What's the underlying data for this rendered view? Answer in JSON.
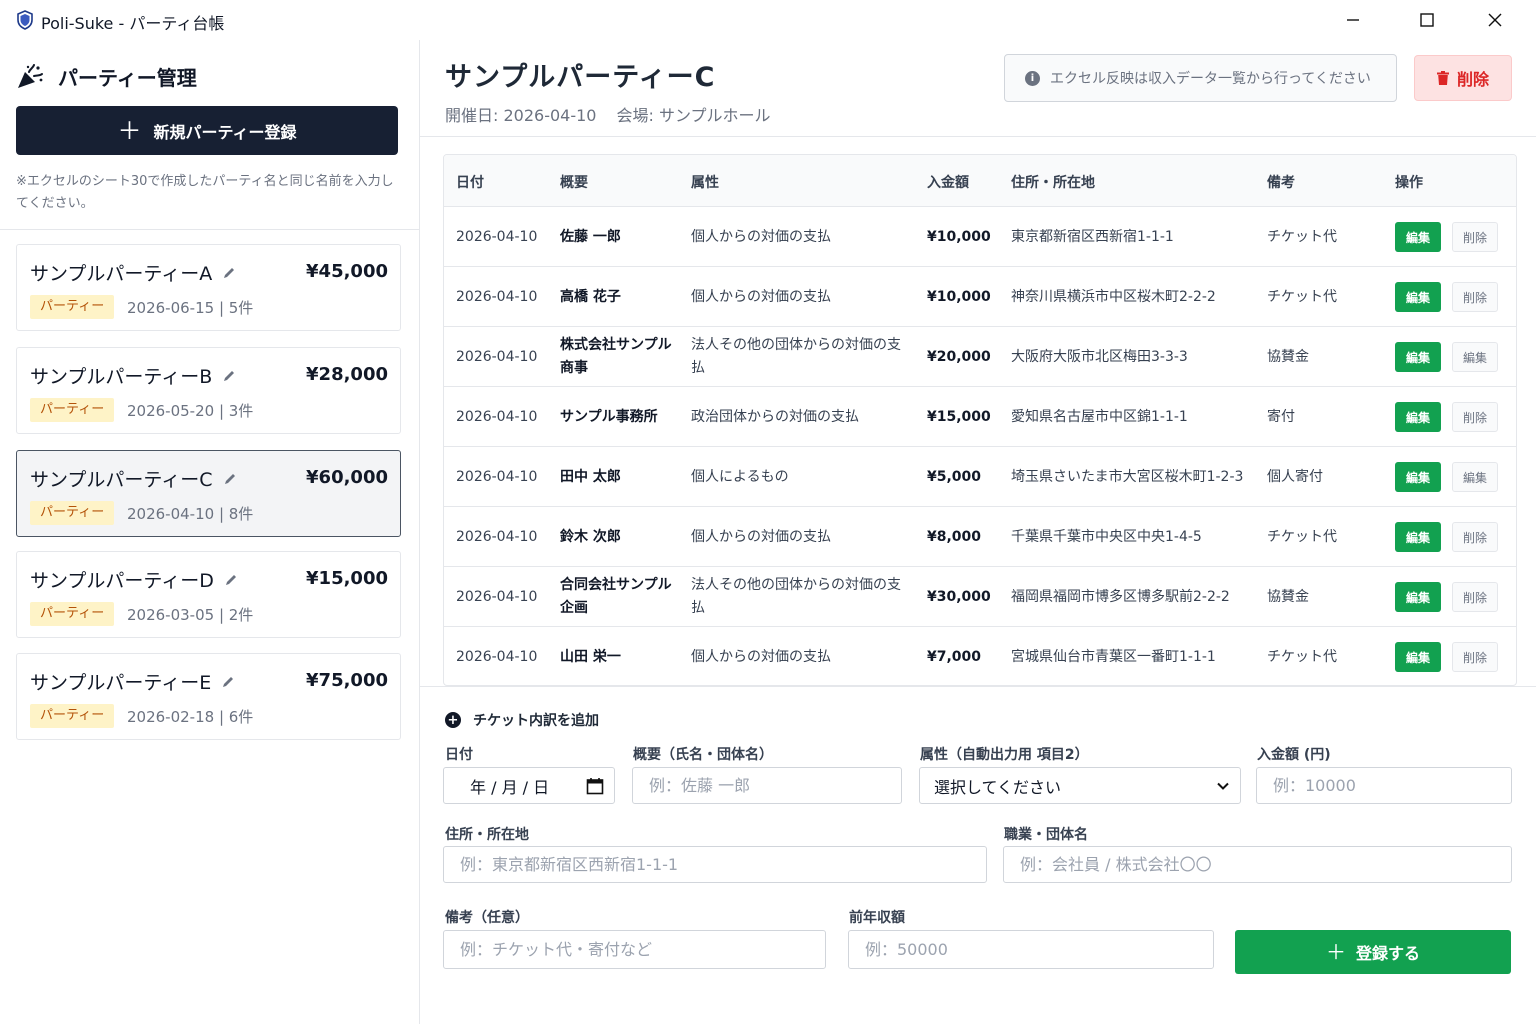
{
  "window": {
    "title": "Poli-Suke - パーティ台帳"
  },
  "sidebar": {
    "title": "パーティー管理",
    "new_button_label": "新規パーティー登録",
    "note": "※エクセルのシート30で作成したパーティ名と同じ名前を入力してください。",
    "parties": [
      {
        "name": "サンプルパーティーA",
        "amount": "¥45,000",
        "badge": "パーティー",
        "meta": "2026-06-15 | 5件",
        "selected": false
      },
      {
        "name": "サンプルパーティーB",
        "amount": "¥28,000",
        "badge": "パーティー",
        "meta": "2026-05-20 | 3件",
        "selected": false
      },
      {
        "name": "サンプルパーティーC",
        "amount": "¥60,000",
        "badge": "パーティー",
        "meta": "2026-04-10 | 8件",
        "selected": true
      },
      {
        "name": "サンプルパーティーD",
        "amount": "¥15,000",
        "badge": "パーティー",
        "meta": "2026-03-05 | 2件",
        "selected": false
      },
      {
        "name": "サンプルパーティーE",
        "amount": "¥75,000",
        "badge": "パーティー",
        "meta": "2026-02-18 | 6件",
        "selected": false
      }
    ]
  },
  "main": {
    "title": "サンプルパーティーC",
    "date_label": "開催日: 2026-04-10",
    "venue_label": "会場: サンプルホール",
    "info_text": "エクセル反映は収入データ一覧から行ってください",
    "delete_label": "削除",
    "table": {
      "headers": {
        "date": "日付",
        "name": "概要",
        "attr": "属性",
        "amount": "入金額",
        "address": "住所・所在地",
        "note": "備考",
        "actions": "操作"
      },
      "rows": [
        {
          "date": "2026-04-10",
          "name": "佐藤 一郎",
          "attr": "個人からの対価の支払",
          "amount": "¥10,000",
          "address": "東京都新宿区西新宿1-1-1",
          "note": "チケット代",
          "edit": "編集",
          "del": "削除"
        },
        {
          "date": "2026-04-10",
          "name": "高橋 花子",
          "attr": "個人からの対価の支払",
          "amount": "¥10,000",
          "address": "神奈川県横浜市中区桜木町2-2-2",
          "note": "チケット代",
          "edit": "編集",
          "del": "削除"
        },
        {
          "date": "2026-04-10",
          "name": "株式会社サンプル商事",
          "attr": "法人その他の団体からの対価の支払",
          "amount": "¥20,000",
          "address": "大阪府大阪市北区梅田3-3-3",
          "note": "協賛金",
          "edit": "編集",
          "del": "編集"
        },
        {
          "date": "2026-04-10",
          "name": "サンプル事務所",
          "attr": "政治団体からの対価の支払",
          "amount": "¥15,000",
          "address": "愛知県名古屋市中区錦1-1-1",
          "note": "寄付",
          "edit": "編集",
          "del": "削除"
        },
        {
          "date": "2026-04-10",
          "name": "田中 太郎",
          "attr": "個人によるもの",
          "amount": "¥5,000",
          "address": "埼玉県さいたま市大宮区桜木町1-2-3",
          "note": "個人寄付",
          "edit": "編集",
          "del": "編集"
        },
        {
          "date": "2026-04-10",
          "name": "鈴木 次郎",
          "attr": "個人からの対価の支払",
          "amount": "¥8,000",
          "address": "千葉県千葉市中央区中央1-4-5",
          "note": "チケット代",
          "edit": "編集",
          "del": "削除"
        },
        {
          "date": "2026-04-10",
          "name": "合同会社サンプル企画",
          "attr": "法人その他の団体からの対価の支払",
          "amount": "¥30,000",
          "address": "福岡県福岡市博多区博多駅前2-2-2",
          "note": "協賛金",
          "edit": "編集",
          "del": "削除"
        },
        {
          "date": "2026-04-10",
          "name": "山田 栄一",
          "attr": "個人からの対価の支払",
          "amount": "¥7,000",
          "address": "宮城県仙台市青葉区一番町1-1-1",
          "note": "チケット代",
          "edit": "編集",
          "del": "削除"
        }
      ]
    }
  },
  "form": {
    "title": "チケット内訳を追加",
    "date_label": "日付",
    "date_value": "年 / 月 / 日",
    "name_label": "概要（氏名・団体名）",
    "name_placeholder": "例：佐藤 一郎",
    "attr_label": "属性（自動出力用 項目2）",
    "attr_value": "選択してください",
    "amount_label": "入金額 (円)",
    "amount_placeholder": "例：10000",
    "address_label": "住所・所在地",
    "address_placeholder": "例：東京都新宿区西新宿1-1-1",
    "job_label": "職業・団体名",
    "job_placeholder": "例：会社員 / 株式会社〇〇",
    "note_label": "備考（任意）",
    "note_placeholder": "例：チケット代・寄付など",
    "income_label": "前年収額",
    "income_placeholder": "例：50000",
    "submit_label": "登録する"
  },
  "colors": {
    "primary_dark": "#172033",
    "success": "#12a150",
    "danger": "#dc2626",
    "badge_bg": "#fef3c7",
    "badge_text": "#b45309"
  }
}
